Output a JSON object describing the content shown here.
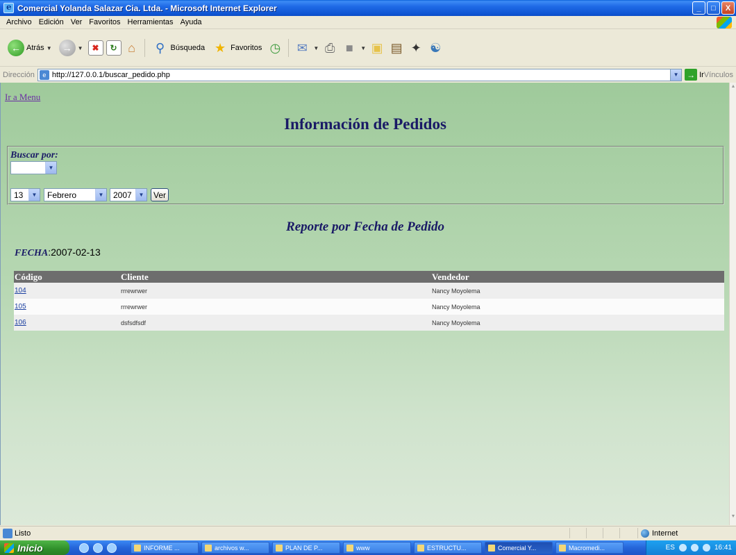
{
  "window": {
    "title": "Comercial Yolanda Salazar Cia. Ltda. - Microsoft Internet Explorer",
    "controls": [
      "_",
      "□",
      "X"
    ]
  },
  "menu": [
    "Archivo",
    "Edición",
    "Ver",
    "Favoritos",
    "Herramientas",
    "Ayuda"
  ],
  "toolbar": {
    "back_label": "Atrás",
    "search_label": "Búsqueda",
    "favorites_label": "Favoritos"
  },
  "address": {
    "label": "Dirección",
    "url": "http://127.0.0.1/buscar_pedido.php",
    "go_label": "Ir",
    "links_label": "Vínculos"
  },
  "page": {
    "menu_link": "Ir a Menu",
    "title": "Información de Pedidos",
    "search_label": "Buscar por:",
    "search_select_value": "",
    "day_value": "13",
    "month_value": "Febrero",
    "year_value": "2007",
    "ver_button": "Ver",
    "report_title": "Reporte por Fecha de Pedido",
    "fecha_label": "FECHA",
    "fecha_value": ":2007-02-13"
  },
  "table": {
    "headers": [
      "Código",
      "Cliente",
      "Vendedor"
    ],
    "rows": [
      {
        "codigo": "104",
        "cliente": "rrrewrwer",
        "vendedor": "Nancy Moyolema"
      },
      {
        "codigo": "105",
        "cliente": "rrrewrwer",
        "vendedor": "Nancy Moyolema"
      },
      {
        "codigo": "106",
        "cliente": "dsfsdfsdf",
        "vendedor": "Nancy Moyolema"
      }
    ]
  },
  "status": {
    "text": "Listo",
    "zone": "Internet"
  },
  "taskbar": {
    "start_label": "Inicio",
    "tasks": [
      "INFORME ...",
      "archivos w...",
      "PLAN DE P...",
      "www",
      "ESTRUCTU...",
      "Comercial Y...",
      "Macromedi..."
    ],
    "lang": "ES",
    "clock": "16:41"
  },
  "colors": {
    "page_bg_top": "#9fca9b",
    "heading": "#1a1a66",
    "table_header_bg": "#6d6d6d"
  }
}
